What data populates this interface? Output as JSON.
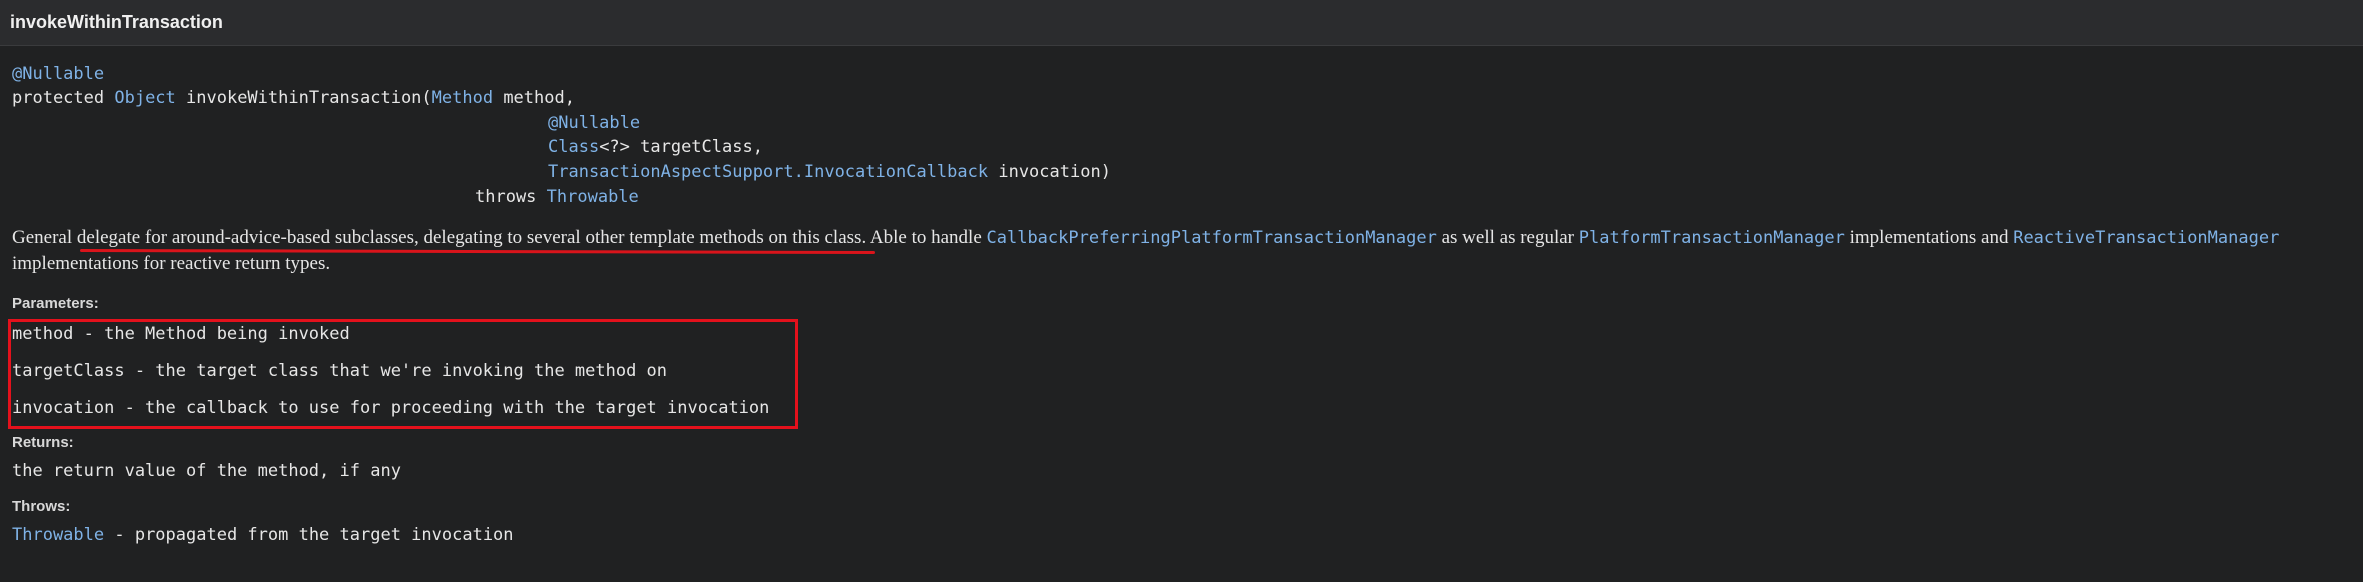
{
  "header": {
    "title": "invokeWithinTransaction"
  },
  "signature": {
    "annotation": "@Nullable",
    "line1": {
      "modifier": "protected ",
      "return_type": "Object",
      "name": " invokeWithinTransaction(",
      "param_type": "Method",
      "param_name": " method,"
    },
    "line2": {
      "annotation": "@Nullable"
    },
    "line3": {
      "param_type": "Class",
      "param_rest": "<?> targetClass,"
    },
    "line4": {
      "param_type": "TransactionAspectSupport.InvocationCallback",
      "param_rest": " invocation)"
    },
    "line5": {
      "keyword": "throws ",
      "exception": "Throwable"
    }
  },
  "description": {
    "part1": "General ",
    "part2": "delegate for around-advice-based subclasses, delegating to several other template methods on this class",
    "part3": ". Able to handle ",
    "code1": "CallbackPreferringPlatformTransactionManager",
    "part4": " as well as regular ",
    "code2": "PlatformTransactionManager",
    "part5": " implementations and ",
    "code3": "ReactiveTransactionManager",
    "part6": "implementations for reactive return types."
  },
  "parameters": {
    "label": "Parameters:",
    "items": [
      "method - the Method being invoked",
      "targetClass - the target class that we're invoking the method on",
      "invocation - the callback to use for proceeding with the target invocation"
    ]
  },
  "returns": {
    "label": "Returns:",
    "text": "the return value of the method, if any"
  },
  "throws": {
    "label": "Throws:",
    "type": "Throwable",
    "text": " - propagated from the target invocation"
  },
  "colors": {
    "background": "#202122",
    "code_link": "#7fb2e6",
    "annotation_red": "#e3111c"
  }
}
